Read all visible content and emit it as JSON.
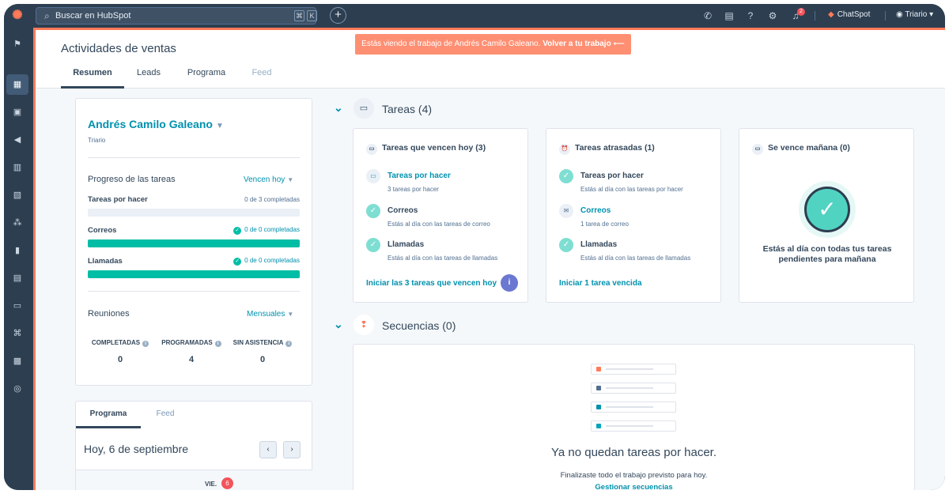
{
  "topbar": {
    "search_placeholder": "Buscar en HubSpot",
    "kbd_cmd": "⌘",
    "kbd_k": "K",
    "notification_count": "2",
    "chatspot_label": "ChatSpot",
    "account_name": "Triario"
  },
  "banner": {
    "text": "Estás viendo el trabajo de Andrés Camilo Galeano.",
    "link": "Volver a tu trabajo"
  },
  "header": {
    "title": "Actividades de ventas",
    "tabs": [
      "Resumen",
      "Leads",
      "Programa",
      "Feed"
    ]
  },
  "summary": {
    "owner_name": "Andrés Camilo Galeano",
    "owner_company": "Triario",
    "progress_title": "Progreso de las tareas",
    "progress_filter": "Vencen hoy",
    "progress_rows": [
      {
        "label": "Tareas por hacer",
        "status": "0 de 3 completadas",
        "fill": 0
      },
      {
        "label": "Correos",
        "status": "0 de 0 completadas",
        "fill": 1
      },
      {
        "label": "Llamadas",
        "status": "0 de 0 completadas",
        "fill": 1
      }
    ],
    "meetings_title": "Reuniones",
    "meetings_filter": "Mensuales",
    "meetings": [
      {
        "label": "COMPLETADAS",
        "value": "0"
      },
      {
        "label": "PROGRAMADAS",
        "value": "4"
      },
      {
        "label": "SIN ASISTENCIA",
        "value": "0"
      }
    ]
  },
  "calendar": {
    "tabs": [
      "Programa",
      "Feed"
    ],
    "date_title": "Hoy, 6 de septiembre",
    "day_label": "VIE.",
    "day_number": "6"
  },
  "tasks_section": {
    "title": "Tareas (4)",
    "cards": [
      {
        "title": "Tareas que vencen hoy (3)",
        "items": [
          {
            "title": "Tareas por hacer",
            "sub": "3 tareas por hacer"
          },
          {
            "title": "Correos",
            "sub": "Estás al día con las tareas de correo"
          },
          {
            "title": "Llamadas",
            "sub": "Estás al día con las tareas de llamadas"
          }
        ],
        "link": "Iniciar las 3 tareas que vencen hoy"
      },
      {
        "title": "Tareas atrasadas (1)",
        "items": [
          {
            "title": "Tareas por hacer",
            "sub": "Estás al día con las tareas por hacer"
          },
          {
            "title": "Correos",
            "sub": "1 tarea de correo"
          },
          {
            "title": "Llamadas",
            "sub": "Estás al día con las tareas de llamadas"
          }
        ],
        "link": "Iniciar 1 tarea vencida"
      },
      {
        "title": "Se vence mañana (0)",
        "done_text": "Estás al día con todas tus tareas pendientes para mañana"
      }
    ]
  },
  "sequences_section": {
    "title": "Secuencias (0)",
    "empty_title": "Ya no quedan tareas por hacer.",
    "empty_sub": "Finalizaste todo el trabajo previsto para hoy.",
    "link": "Gestionar secuencias"
  },
  "icons": {
    "accent": "#ff7a59",
    "link": "#0091ae",
    "success": "#00bda5",
    "danger": "#f2545b"
  }
}
